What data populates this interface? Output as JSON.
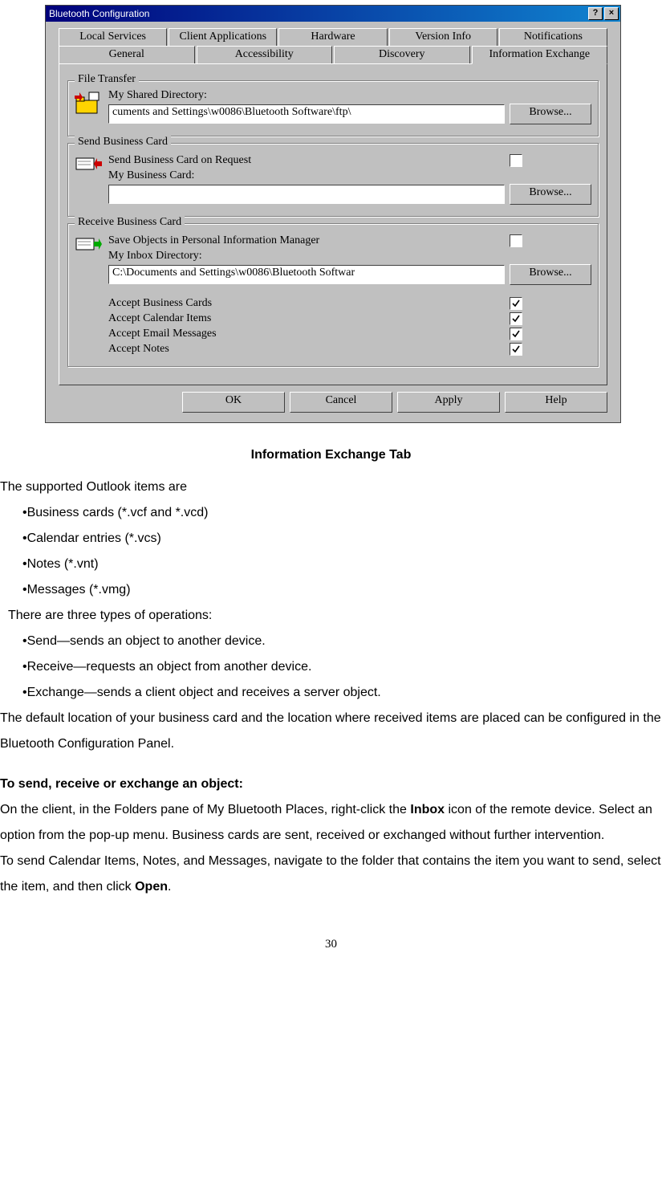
{
  "dialog": {
    "title": "Bluetooth Configuration",
    "help_btn": "?",
    "close_btn": "×",
    "tabs_row1": [
      "Local Services",
      "Client Applications",
      "Hardware",
      "Version Info",
      "Notifications"
    ],
    "tabs_row2": [
      "General",
      "Accessibility",
      "Discovery",
      "Information Exchange"
    ],
    "file_transfer": {
      "legend": "File Transfer",
      "label": "My Shared Directory:",
      "value": "cuments and Settings\\w0086\\Bluetooth Software\\ftp\\",
      "browse": "Browse..."
    },
    "send_card": {
      "legend": "Send Business Card",
      "request_label": "Send Business Card on Request",
      "request_checked": false,
      "my_card_label": "My Business Card:",
      "value": "",
      "browse": "Browse..."
    },
    "receive_card": {
      "legend": "Receive Business Card",
      "save_label": "Save Objects in Personal Information Manager",
      "save_checked": false,
      "inbox_label": "My Inbox Directory:",
      "value": "C:\\Documents and Settings\\w0086\\Bluetooth Softwar",
      "browse": "Browse...",
      "accepts": [
        {
          "label": "Accept Business Cards",
          "checked": true
        },
        {
          "label": "Accept Calendar Items",
          "checked": true
        },
        {
          "label": "Accept Email Messages",
          "checked": true
        },
        {
          "label": "Accept Notes",
          "checked": true
        }
      ]
    },
    "buttons": {
      "ok": "OK",
      "cancel": "Cancel",
      "apply": "Apply",
      "help": "Help"
    }
  },
  "doc": {
    "caption": "Information Exchange Tab",
    "p1": "The supported Outlook items are",
    "b1": "•Business cards (*.vcf and *.vcd)",
    "b2": "•Calendar entries (*.vcs)",
    "b3": "•Notes (*.vnt)",
    "b4": "•Messages (*.vmg)",
    "p2": "There are three types of operations:",
    "b5": "•Send—sends an object to another device.",
    "b6": "•Receive—requests an object from another device.",
    "b7": "•Exchange—sends a client object and receives a server object.",
    "p3": "The default location of your business card and the location where received items are placed can be configured in the Bluetooth Configuration Panel.",
    "h1": "To send, receive or exchange an object:",
    "p4a": "On the client, in the Folders pane of My Bluetooth Places, right-click the ",
    "p4b": "Inbox",
    "p4c": " icon of the remote device. Select an option from the pop-up menu. Business cards are sent, received or exchanged without further intervention.",
    "p5a": "To send Calendar Items, Notes, and Messages, navigate to the folder that contains the item you want to send, select the item, and then click ",
    "p5b": "Open",
    "p5c": ".",
    "pagenum": "30"
  }
}
